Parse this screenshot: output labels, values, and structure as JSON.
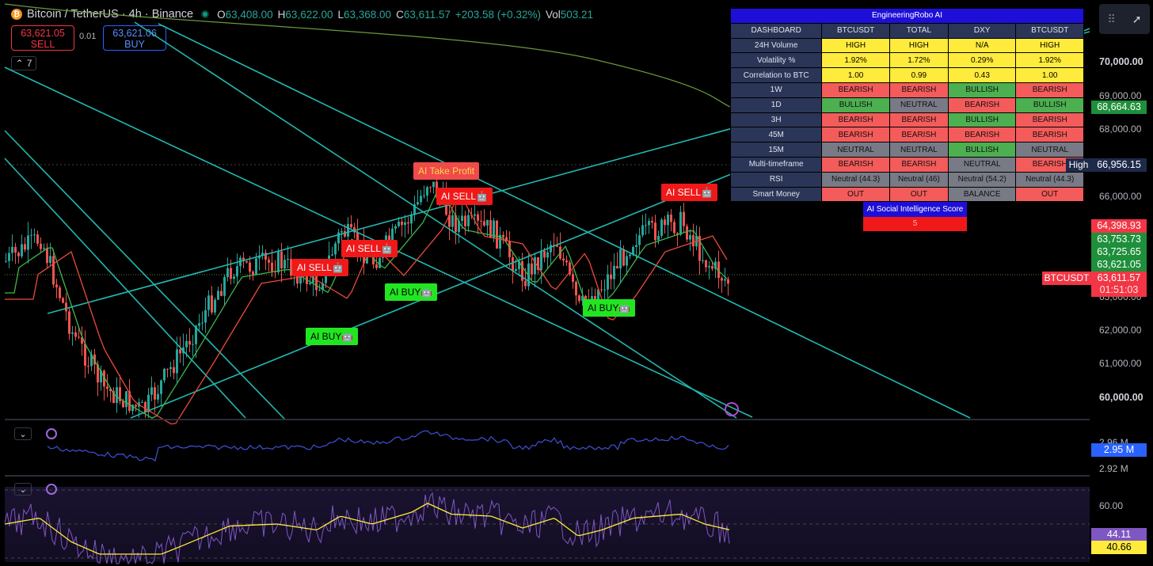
{
  "header": {
    "coin_icon": "bitcoin-icon",
    "symbol_title": "Bitcoin / TetherUS · 4h · Binance",
    "ohlc": [
      {
        "k": "O",
        "v": "63,408.00"
      },
      {
        "k": "H",
        "v": "63,622.00"
      },
      {
        "k": "L",
        "v": "63,368.00"
      },
      {
        "k": "C",
        "v": "63,611.57"
      },
      {
        "k": "",
        "v": "+203.58 (+0.32%)"
      },
      {
        "k": "Vol",
        "v": "503.21"
      }
    ],
    "sell_price": "63,621.05",
    "sell_label": "SELL",
    "spread": "0.01",
    "buy_price": "63,621.06",
    "buy_label": "BUY",
    "indicator_count": "7"
  },
  "dashboard": {
    "title": "EngineeringRobo AI",
    "columns": [
      "DASHBOARD",
      "BTCUSDT",
      "TOTAL",
      "DXY",
      "BTCUSDT"
    ],
    "rows": [
      {
        "label": "24H Volume",
        "cells": [
          [
            "HIGH",
            "y"
          ],
          [
            "HIGH",
            "y"
          ],
          [
            "N/A",
            "y"
          ],
          [
            "HIGH",
            "y"
          ]
        ]
      },
      {
        "label": "Volatility %",
        "cells": [
          [
            "1.92%",
            "y"
          ],
          [
            "1.72%",
            "y"
          ],
          [
            "0.29%",
            "y"
          ],
          [
            "1.92%",
            "y"
          ]
        ]
      },
      {
        "label": "Correlation to BTC",
        "cells": [
          [
            "1.00",
            "y"
          ],
          [
            "0.99",
            "y"
          ],
          [
            "0.43",
            "y"
          ],
          [
            "1.00",
            "y"
          ]
        ]
      },
      {
        "label": "1W",
        "cells": [
          [
            "BEARISH",
            "r"
          ],
          [
            "BEARISH",
            "r"
          ],
          [
            "BULLISH",
            "g"
          ],
          [
            "BEARISH",
            "r"
          ]
        ]
      },
      {
        "label": "1D",
        "cells": [
          [
            "BULLISH",
            "g"
          ],
          [
            "NEUTRAL",
            "n"
          ],
          [
            "BEARISH",
            "r"
          ],
          [
            "BULLISH",
            "g"
          ]
        ]
      },
      {
        "label": "3H",
        "cells": [
          [
            "BEARISH",
            "r"
          ],
          [
            "BEARISH",
            "r"
          ],
          [
            "BULLISH",
            "g"
          ],
          [
            "BEARISH",
            "r"
          ]
        ]
      },
      {
        "label": "45M",
        "cells": [
          [
            "BEARISH",
            "r"
          ],
          [
            "BEARISH",
            "r"
          ],
          [
            "BEARISH",
            "r"
          ],
          [
            "BEARISH",
            "r"
          ]
        ]
      },
      {
        "label": "15M",
        "cells": [
          [
            "NEUTRAL",
            "n"
          ],
          [
            "NEUTRAL",
            "n"
          ],
          [
            "BULLISH",
            "g"
          ],
          [
            "NEUTRAL",
            "n"
          ]
        ]
      },
      {
        "label": "Multi-timeframe",
        "cells": [
          [
            "BEARISH",
            "r"
          ],
          [
            "BEARISH",
            "r"
          ],
          [
            "NEUTRAL",
            "n"
          ],
          [
            "BEARISH",
            "r"
          ]
        ]
      },
      {
        "label": "RSI",
        "cells": [
          [
            "Neutral (44.3)",
            "n"
          ],
          [
            "Neutral (46)",
            "n"
          ],
          [
            "Neutral (54.2)",
            "n"
          ],
          [
            "Neutral (44.3)",
            "n"
          ]
        ]
      },
      {
        "label": "Smart Money",
        "cells": [
          [
            "OUT",
            "r"
          ],
          [
            "OUT",
            "r"
          ],
          [
            "BALANCE",
            "n"
          ],
          [
            "OUT",
            "r"
          ]
        ]
      }
    ],
    "social_title": "AI Social Intelligence Score",
    "social_value": "5"
  },
  "signals": [
    {
      "text": "AI Take Profit",
      "kind": "tp"
    },
    {
      "text": "AI SELL🤖",
      "kind": "sell"
    },
    {
      "text": "AI SELL🤖",
      "kind": "sell"
    },
    {
      "text": "AI SELL🤖",
      "kind": "sell"
    },
    {
      "text": "AI SELL🤖",
      "kind": "sell"
    },
    {
      "text": "AI BUY🤖",
      "kind": "buy"
    },
    {
      "text": "AI BUY🤖",
      "kind": "buy"
    },
    {
      "text": "AI BUY🤖",
      "kind": "buy"
    }
  ],
  "price_axis": {
    "ticks": [
      "70,000.00",
      "69,000.00",
      "68,000.00",
      "66,000.00",
      "63,000.00",
      "62,000.00",
      "61,000.00",
      "60,000.00"
    ],
    "labels": [
      {
        "text": "68,664.63",
        "color": "#1e8f3a"
      },
      {
        "text": "66,956.15",
        "color": "#1e2a4a"
      },
      {
        "text": "64,398.93",
        "color": "#f23645"
      },
      {
        "text": "63,753.73",
        "color": "#1e8f3a"
      },
      {
        "text": "63,725.65",
        "color": "#1e8f3a"
      },
      {
        "text": "63,621.05",
        "color": "#1e8f3a"
      },
      {
        "text": "63,611.57",
        "color": "#f23645"
      },
      {
        "text": "01:51:03",
        "color": "#f23645"
      }
    ],
    "high_label": "High",
    "symbol_tag": "BTCUSDT"
  },
  "pane2": {
    "ticks": [
      "2.96 M",
      "2.92 M"
    ],
    "current": "2.95 M"
  },
  "pane3": {
    "ticks": [
      "60.00"
    ],
    "rsi": "44.11",
    "rsi_ma": "40.66"
  },
  "toolbar": {
    "drag_icon": "drag-handle-icon",
    "cursor_icon": "cursor-icon"
  },
  "colors": {
    "up": "#26a69a",
    "down": "#ef5350",
    "channel": "#22b8b0",
    "volume_line": "#3f51d8",
    "rsi_line": "#7e57c2",
    "rsi_ma": "#ffeb3b"
  }
}
